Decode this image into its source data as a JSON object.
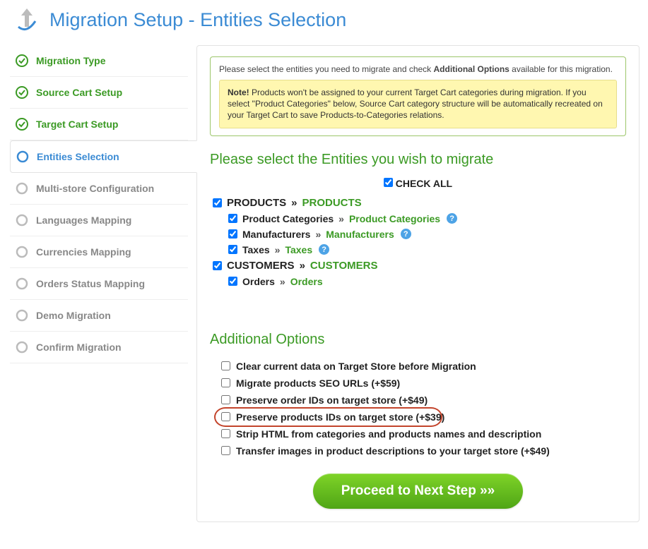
{
  "header": {
    "title": "Migration Setup - Entities Selection"
  },
  "sidebar": {
    "items": [
      {
        "label": "Migration Type",
        "state": "done"
      },
      {
        "label": "Source Cart Setup",
        "state": "done"
      },
      {
        "label": "Target Cart Setup",
        "state": "done"
      },
      {
        "label": "Entities Selection",
        "state": "active"
      },
      {
        "label": "Multi-store Configuration",
        "state": "future"
      },
      {
        "label": "Languages Mapping",
        "state": "future"
      },
      {
        "label": "Currencies Mapping",
        "state": "future"
      },
      {
        "label": "Orders Status Mapping",
        "state": "future"
      },
      {
        "label": "Demo Migration",
        "state": "future"
      },
      {
        "label": "Confirm Migration",
        "state": "future"
      }
    ]
  },
  "info": {
    "lead_prefix": "Please select the entities you need to migrate and check ",
    "lead_bold": "Additional Options",
    "lead_suffix": " available for this migration.",
    "note_bold": "Note! ",
    "note_text": "Products won't be assigned to your current Target Cart categories during migration. If you select \"Product Categories\" below, Source Cart category structure will be automatically recreated on your Target Cart to save Products-to-Categories relations."
  },
  "entities": {
    "title": "Please select the Entities you wish to migrate",
    "check_all_label": "CHECK ALL",
    "check_all_checked": true,
    "groups": [
      {
        "source": "PRODUCTS",
        "target": "PRODUCTS",
        "checked": true,
        "children": [
          {
            "source": "Product Categories",
            "target": "Product Categories",
            "checked": true,
            "help": true
          },
          {
            "source": "Manufacturers",
            "target": "Manufacturers",
            "checked": true,
            "help": true
          },
          {
            "source": "Taxes",
            "target": "Taxes",
            "checked": true,
            "help": true
          }
        ]
      },
      {
        "source": "CUSTOMERS",
        "target": "CUSTOMERS",
        "checked": true,
        "children": [
          {
            "source": "Orders",
            "target": "Orders",
            "checked": true,
            "help": false
          }
        ]
      }
    ]
  },
  "options": {
    "title": "Additional Options",
    "items": [
      {
        "label": "Clear current data on Target Store before Migration",
        "checked": false,
        "highlight": false
      },
      {
        "label": "Migrate products SEO URLs (+$59)",
        "checked": false,
        "highlight": false
      },
      {
        "label": "Preserve order IDs on target store (+$49)",
        "checked": false,
        "highlight": false
      },
      {
        "label": "Preserve products IDs on target store (+$39)",
        "checked": false,
        "highlight": true
      },
      {
        "label": "Strip HTML from categories and products names and description",
        "checked": false,
        "highlight": false
      },
      {
        "label": "Transfer images in product descriptions to your target store (+$49)",
        "checked": false,
        "highlight": false
      }
    ]
  },
  "proceed": {
    "label": "Proceed to Next Step »»"
  }
}
